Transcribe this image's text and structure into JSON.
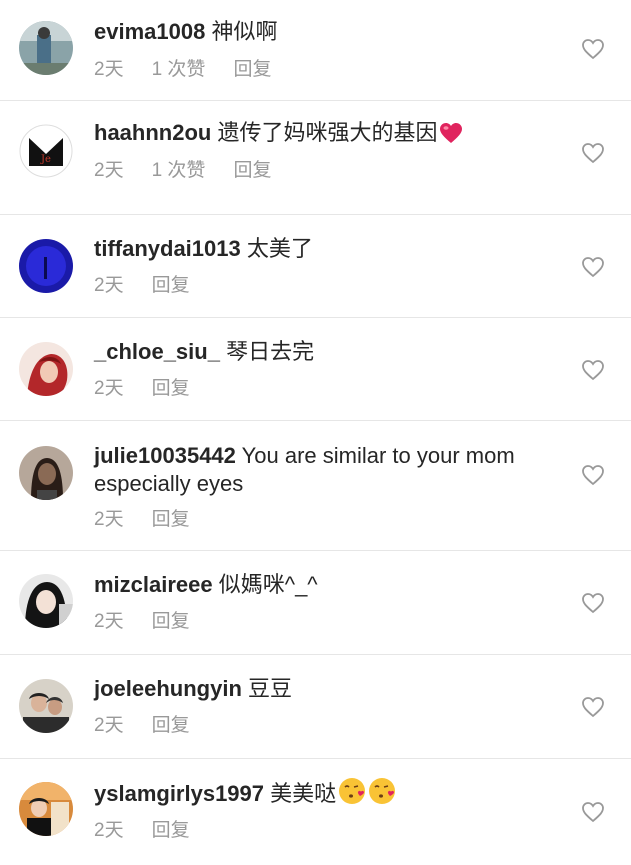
{
  "comments": [
    {
      "username": "evima1008",
      "text": " 神似啊",
      "time": "2天",
      "likes": "1 次赞",
      "reply": "回复"
    },
    {
      "username": "haahnn2ou",
      "text": " 遗传了妈咪强大的基因",
      "time": "2天",
      "likes": "1 次赞",
      "reply": "回复"
    },
    {
      "username": "tiffanydai1013",
      "text": " 太美了",
      "time": "2天",
      "reply": "回复"
    },
    {
      "username": "_chloe_siu_",
      "text": " 琴日去完",
      "time": "2天",
      "reply": "回复"
    },
    {
      "username": "julie10035442",
      "text": " You are similar to your mom especially eyes",
      "time": "2天",
      "reply": "回复"
    },
    {
      "username": "mizclaireee",
      "text": " 似媽咪^_^",
      "time": "2天",
      "reply": "回复"
    },
    {
      "username": "joeleehungyin",
      "text": " 豆豆",
      "time": "2天",
      "reply": "回复"
    },
    {
      "username": "yslamgirlys1997",
      "text": " 美美哒",
      "time": "2天",
      "reply": "回复"
    }
  ],
  "icons": {
    "like": "heart-outline-icon",
    "emoji_heart": "red-heart-emoji",
    "emoji_kiss": "face-blowing-kiss-emoji"
  },
  "colors": {
    "username": "#262626",
    "meta": "#999999",
    "divider": "#e6e6e6",
    "heart_emoji": "#e0245e"
  }
}
